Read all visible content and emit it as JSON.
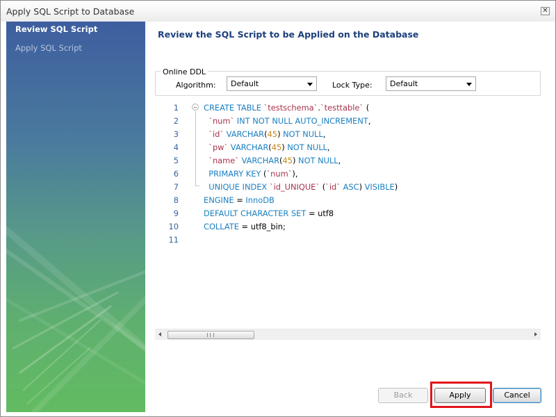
{
  "window": {
    "title": "Apply SQL Script to Database"
  },
  "sidebar": {
    "steps": [
      {
        "label": "Review SQL Script"
      },
      {
        "label": "Apply SQL Script"
      }
    ]
  },
  "main": {
    "heading": "Review the SQL Script to be Applied on the Database",
    "online_ddl": {
      "legend": "Online DDL",
      "algorithm_label": "Algorithm:",
      "algorithm_value": "Default",
      "lock_type_label": "Lock Type:",
      "lock_type_value": "Default"
    },
    "script": {
      "line_numbers": [
        "1",
        "2",
        "3",
        "4",
        "5",
        "6",
        "7",
        "8",
        "9",
        "10",
        "11"
      ],
      "lines": [
        [
          [
            "kw",
            "CREATE TABLE "
          ],
          [
            "id",
            "`testschema`"
          ],
          [
            "pl",
            "."
          ],
          [
            "id",
            "`testtable`"
          ],
          [
            "pl",
            " ("
          ]
        ],
        [
          [
            "pl",
            "  "
          ],
          [
            "id",
            "`num`"
          ],
          [
            "kw",
            " INT NOT NULL AUTO_INCREMENT"
          ],
          [
            "pl",
            ","
          ]
        ],
        [
          [
            "pl",
            "  "
          ],
          [
            "id",
            "`id`"
          ],
          [
            "kw",
            " VARCHAR"
          ],
          [
            "pl",
            "("
          ],
          [
            "num",
            "45"
          ],
          [
            "pl",
            ")"
          ],
          [
            "kw",
            " NOT NULL"
          ],
          [
            "pl",
            ","
          ]
        ],
        [
          [
            "pl",
            "  "
          ],
          [
            "id",
            "`pw`"
          ],
          [
            "kw",
            " VARCHAR"
          ],
          [
            "pl",
            "("
          ],
          [
            "num",
            "45"
          ],
          [
            "pl",
            ")"
          ],
          [
            "kw",
            " NOT NULL"
          ],
          [
            "pl",
            ","
          ]
        ],
        [
          [
            "pl",
            "  "
          ],
          [
            "id",
            "`name`"
          ],
          [
            "kw",
            " VARCHAR"
          ],
          [
            "pl",
            "("
          ],
          [
            "num",
            "45"
          ],
          [
            "pl",
            ")"
          ],
          [
            "kw",
            " NOT NULL"
          ],
          [
            "pl",
            ","
          ]
        ],
        [
          [
            "pl",
            "  "
          ],
          [
            "kw",
            "PRIMARY KEY"
          ],
          [
            "pl",
            " ("
          ],
          [
            "id",
            "`num`"
          ],
          [
            "pl",
            "),"
          ]
        ],
        [
          [
            "pl",
            "  "
          ],
          [
            "kw",
            "UNIQUE INDEX "
          ],
          [
            "id",
            "`id_UNIQUE`"
          ],
          [
            "pl",
            " ("
          ],
          [
            "id",
            "`id`"
          ],
          [
            "kw",
            " ASC"
          ],
          [
            "pl",
            ")"
          ],
          [
            "kw",
            " VISIBLE"
          ],
          [
            "pl",
            ")"
          ]
        ],
        [
          [
            "kw",
            "ENGINE"
          ],
          [
            "pl",
            " = "
          ],
          [
            "kw",
            "InnoDB"
          ]
        ],
        [
          [
            "kw",
            "DEFAULT CHARACTER SET"
          ],
          [
            "pl",
            " = utf8"
          ]
        ],
        [
          [
            "kw",
            "COLLATE"
          ],
          [
            "pl",
            " = utf8_bin;"
          ]
        ],
        []
      ]
    }
  },
  "buttons": {
    "back": "Back",
    "apply": "Apply",
    "cancel": "Cancel"
  },
  "colors": {
    "keyword": "#1a7fc1",
    "identifier": "#a8334c",
    "number": "#c6891a",
    "heading": "#1d3f7c",
    "highlight": "#e2141a"
  }
}
